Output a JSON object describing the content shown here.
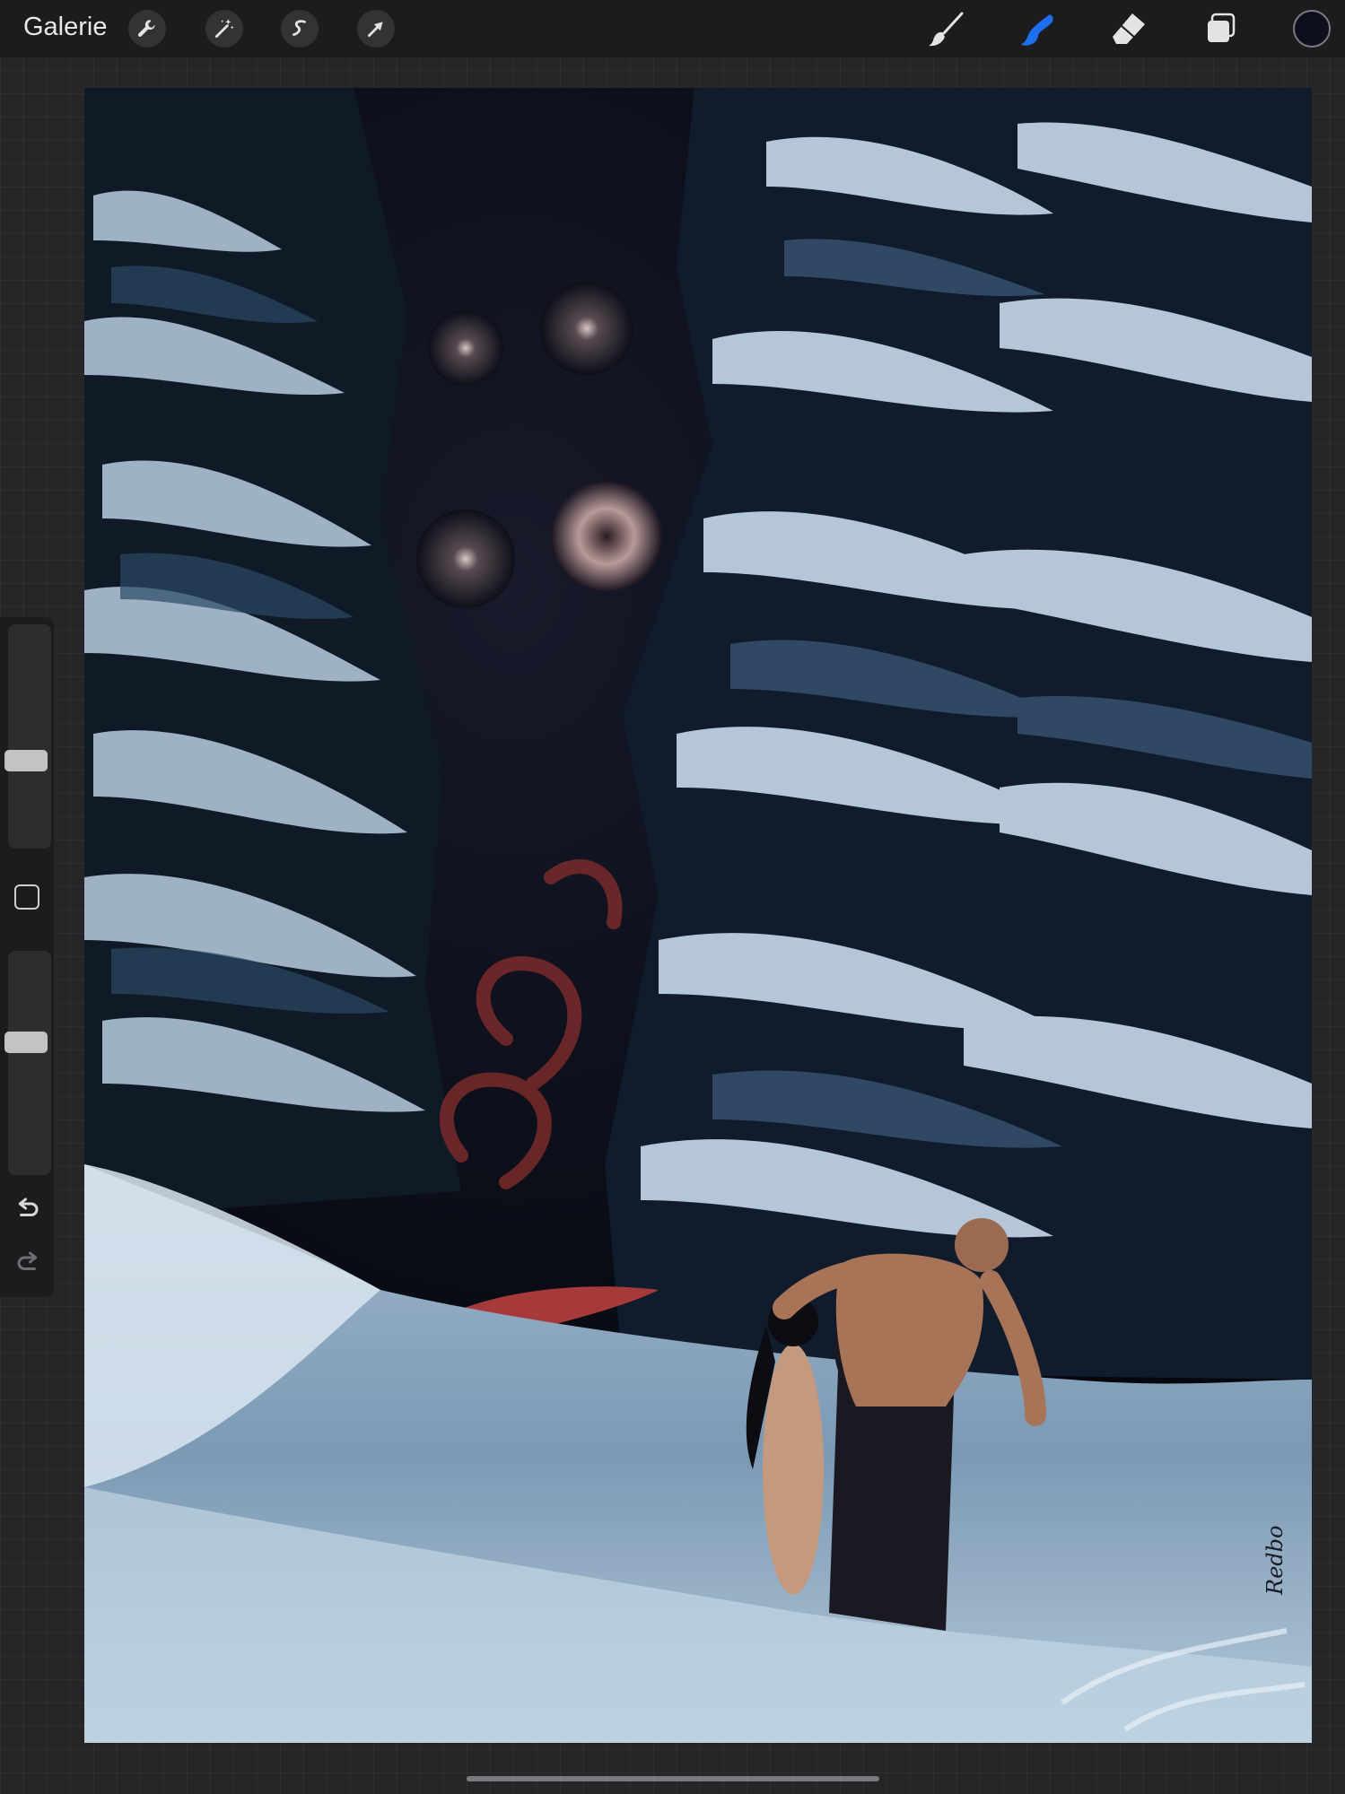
{
  "topbar": {
    "gallery_label": "Galerie",
    "left_tools": [
      "wrench-icon",
      "magic-wand-icon",
      "selection-s-icon",
      "transform-arrow-icon"
    ],
    "right_tools": [
      "brush-icon",
      "smudge-icon",
      "eraser-icon",
      "layers-icon"
    ],
    "active_tool": "smudge",
    "accent_color": "#1e6ff0",
    "current_color": "#0d0f1e"
  },
  "canvas": {
    "signature_text": "Redbo"
  },
  "sidebar": {
    "size_slider_value": 0.4,
    "opacity_slider_value": 0.6
  }
}
